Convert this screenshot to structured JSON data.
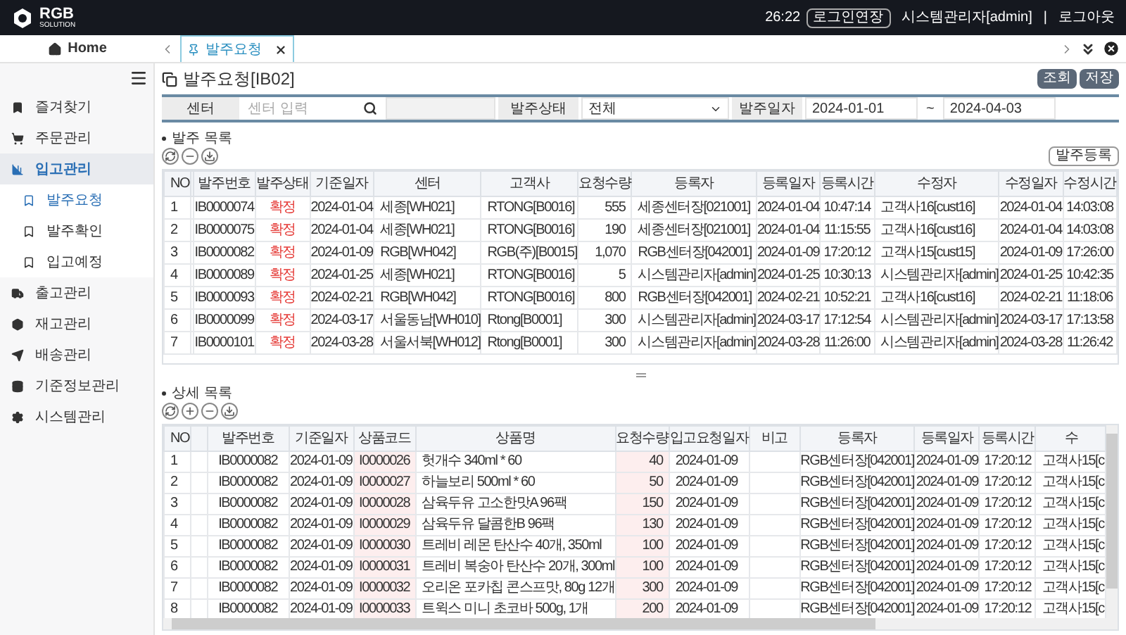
{
  "header": {
    "logo": "RGB",
    "logo_sub": "SOLUTION",
    "timer": "26:22",
    "extend_button": "로그인연장",
    "user": "시스템관리자[admin]",
    "separator": "|",
    "logout": "로그아웃"
  },
  "tabbar": {
    "home": "Home",
    "tabs": [
      {
        "label": "발주요청",
        "selected": true
      }
    ]
  },
  "sidebar": {
    "items": [
      {
        "label": "즐겨찾기",
        "selected": false
      },
      {
        "label": "주문관리",
        "selected": false
      },
      {
        "label": "입고관리",
        "selected": true,
        "children": [
          {
            "label": "발주요청",
            "selected": true
          },
          {
            "label": "발주확인",
            "selected": false
          },
          {
            "label": "입고예정",
            "selected": false
          }
        ]
      },
      {
        "label": "출고관리",
        "selected": false
      },
      {
        "label": "재고관리",
        "selected": false
      },
      {
        "label": "배송관리",
        "selected": false
      },
      {
        "label": "기준정보관리",
        "selected": false
      },
      {
        "label": "시스템관리",
        "selected": false
      }
    ]
  },
  "page": {
    "title": "발주요청[IB02]",
    "buttons": [
      "조회",
      "저장"
    ]
  },
  "filters": {
    "center_label": "센터",
    "center_placeholder": "센터 입력",
    "status_label": "발주상태",
    "status_value": "전체",
    "date_label": "발주일자",
    "date_from": "2024-01-01",
    "date_sep": "~",
    "date_to": "2024-04-03"
  },
  "master": {
    "title": "발주 목록",
    "register_button": "발주등록",
    "columns": [
      {
        "label": "NO",
        "kind": "no"
      },
      {
        "kind": "blank"
      },
      {
        "label": "발주번호",
        "kind": "text"
      },
      {
        "label": "발주상태",
        "kind": "status"
      },
      {
        "label": "기준일자",
        "kind": "text"
      },
      {
        "label": "센터",
        "kind": "left"
      },
      {
        "label": "고객사",
        "kind": "left"
      },
      {
        "label": "요청수량",
        "kind": "num"
      },
      {
        "label": "등록자",
        "kind": "left"
      },
      {
        "label": "등록일자",
        "kind": "text"
      },
      {
        "label": "등록시간",
        "kind": "text"
      },
      {
        "label": "수정자",
        "kind": "left"
      },
      {
        "label": "수정일자",
        "kind": "text"
      },
      {
        "label": "수정시간",
        "kind": "text"
      }
    ],
    "rows": [
      [
        "1",
        "",
        "IB0000074",
        "확정",
        "2024-01-04",
        "세종[WH021]",
        "RTONG[B0016]",
        "555",
        "세종센터장[021001]",
        "2024-01-04",
        "10:47:14",
        "고객사16[cust16]",
        "2024-01-04",
        "14:03:08"
      ],
      [
        "2",
        "",
        "IB0000075",
        "확정",
        "2024-01-04",
        "세종[WH021]",
        "RTONG[B0016]",
        "190",
        "세종센터장[021001]",
        "2024-01-04",
        "11:15:55",
        "고객사16[cust16]",
        "2024-01-04",
        "14:03:08"
      ],
      [
        "3",
        "",
        "IB0000082",
        "확정",
        "2024-01-09",
        "RGB[WH042]",
        "RGB(주)[B0015]",
        "1,070",
        "RGB센터장[042001]",
        "2024-01-09",
        "17:20:12",
        "고객사15[cust15]",
        "2024-01-09",
        "17:26:00"
      ],
      [
        "4",
        "",
        "IB0000089",
        "확정",
        "2024-01-25",
        "세종[WH021]",
        "RTONG[B0016]",
        "5",
        "시스템관리자[admin]",
        "2024-01-25",
        "10:30:13",
        "시스템관리자[admin]",
        "2024-01-25",
        "10:42:35"
      ],
      [
        "5",
        "",
        "IB0000093",
        "확정",
        "2024-02-21",
        "RGB[WH042]",
        "RTONG[B0016]",
        "800",
        "RGB센터장[042001]",
        "2024-02-21",
        "10:52:21",
        "고객사16[cust16]",
        "2024-02-21",
        "11:18:06"
      ],
      [
        "6",
        "",
        "IB0000099",
        "확정",
        "2024-03-17",
        "서울동남[WH010]",
        "Rtong[B0001]",
        "300",
        "시스템관리자[admin]",
        "2024-03-17",
        "17:12:54",
        "시스템관리자[admin]",
        "2024-03-17",
        "17:13:58"
      ],
      [
        "7",
        "",
        "IB0000101",
        "확정",
        "2024-03-28",
        "서울서북[WH012]",
        "Rtong[B0001]",
        "300",
        "시스템관리자[admin]",
        "2024-03-28",
        "11:26:00",
        "시스템관리자[admin]",
        "2024-03-28",
        "11:26:42"
      ]
    ]
  },
  "detail": {
    "title": "상세 목록",
    "columns": [
      {
        "label": "NO",
        "kind": "no"
      },
      {
        "kind": "blank"
      },
      {
        "label": "발주번호",
        "kind": "text"
      },
      {
        "label": "기준일자",
        "kind": "text"
      },
      {
        "label": "상품코드",
        "kind": "code"
      },
      {
        "label": "상품명",
        "kind": "left"
      },
      {
        "label": "요청수량",
        "kind": "qty"
      },
      {
        "label": "입고요청일자",
        "kind": "left"
      },
      {
        "label": "비고",
        "kind": "left"
      },
      {
        "label": "등록자",
        "kind": "text"
      },
      {
        "label": "등록일자",
        "kind": "text"
      },
      {
        "label": "등록시간",
        "kind": "text"
      },
      {
        "label": "수",
        "kind": "left"
      }
    ],
    "rows": [
      [
        "1",
        "",
        "IB0000082",
        "2024-01-09",
        "I0000026",
        "헛개수 340ml * 60",
        "40",
        "2024-01-09",
        "",
        "RGB센터장[042001]",
        "2024-01-09",
        "17:20:12",
        "고객사15[c"
      ],
      [
        "2",
        "",
        "IB0000082",
        "2024-01-09",
        "I0000027",
        "하늘보리 500ml * 60",
        "50",
        "2024-01-09",
        "",
        "RGB센터장[042001]",
        "2024-01-09",
        "17:20:12",
        "고객사15[c"
      ],
      [
        "3",
        "",
        "IB0000082",
        "2024-01-09",
        "I0000028",
        "삼육두유 고소한맛A 96팩",
        "150",
        "2024-01-09",
        "",
        "RGB센터장[042001]",
        "2024-01-09",
        "17:20:12",
        "고객사15[c"
      ],
      [
        "4",
        "",
        "IB0000082",
        "2024-01-09",
        "I0000029",
        "삼육두유 달콤한B 96팩",
        "130",
        "2024-01-09",
        "",
        "RGB센터장[042001]",
        "2024-01-09",
        "17:20:12",
        "고객사15[c"
      ],
      [
        "5",
        "",
        "IB0000082",
        "2024-01-09",
        "I0000030",
        "트레비 레몬 탄산수 40개, 350ml",
        "100",
        "2024-01-09",
        "",
        "RGB센터장[042001]",
        "2024-01-09",
        "17:20:12",
        "고객사15[c"
      ],
      [
        "6",
        "",
        "IB0000082",
        "2024-01-09",
        "I0000031",
        "트레비 복숭아 탄산수 20개, 300ml",
        "100",
        "2024-01-09",
        "",
        "RGB센터장[042001]",
        "2024-01-09",
        "17:20:12",
        "고객사15[c"
      ],
      [
        "7",
        "",
        "IB0000082",
        "2024-01-09",
        "I0000032",
        "오리온 포카칩 콘스프맛, 80g 12개",
        "300",
        "2024-01-09",
        "",
        "RGB센터장[042001]",
        "2024-01-09",
        "17:20:12",
        "고객사15[c"
      ],
      [
        "8",
        "",
        "IB0000082",
        "2024-01-09",
        "I0000033",
        "트윅스 미니 초코바 500g, 1개",
        "200",
        "2024-01-09",
        "",
        "RGB센터장[042001]",
        "2024-01-09",
        "17:20:12",
        "고객사15[c"
      ]
    ]
  }
}
